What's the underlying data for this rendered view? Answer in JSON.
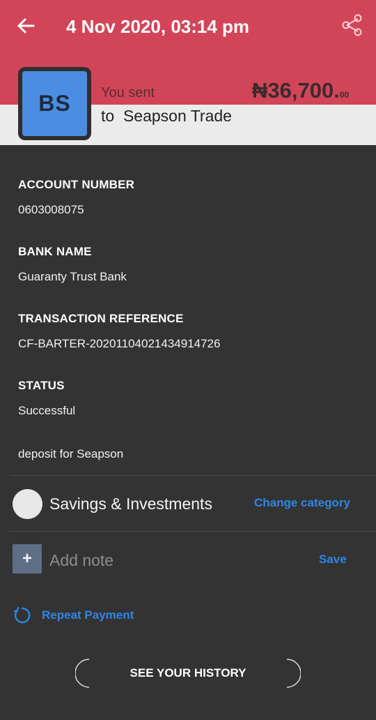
{
  "header": {
    "title": "4 Nov 2020, 03:14 pm",
    "back_icon": "arrow-left-icon",
    "share_icon": "share-icon"
  },
  "summary": {
    "avatar_initials": "BS",
    "you_sent_label": "You sent",
    "amount_main": "₦36,700.",
    "amount_cents": "00",
    "recipient": "to  Seapson Trade"
  },
  "details": {
    "account_number_label": "ACCOUNT NUMBER",
    "account_number": "0603008075",
    "bank_name_label": "BANK NAME",
    "bank_name": "Guaranty Trust Bank",
    "reference_label": "TRANSACTION REFERENCE",
    "reference": "CF-BARTER-20201104021434914726",
    "status_label": "STATUS",
    "status": "Successful",
    "narration": "deposit for Seapson"
  },
  "category": {
    "name": "Savings & Investments",
    "change_label": "Change category"
  },
  "note": {
    "plus_symbol": "+",
    "placeholder": "Add note",
    "save_label": "Save"
  },
  "repeat": {
    "label": "Repeat Payment"
  },
  "history": {
    "label": "SEE YOUR HISTORY"
  },
  "colors": {
    "header_bg": "#d24558",
    "accent_blue": "#2f86e6",
    "avatar_blue": "#4a8de3",
    "body_bg": "#333333"
  }
}
